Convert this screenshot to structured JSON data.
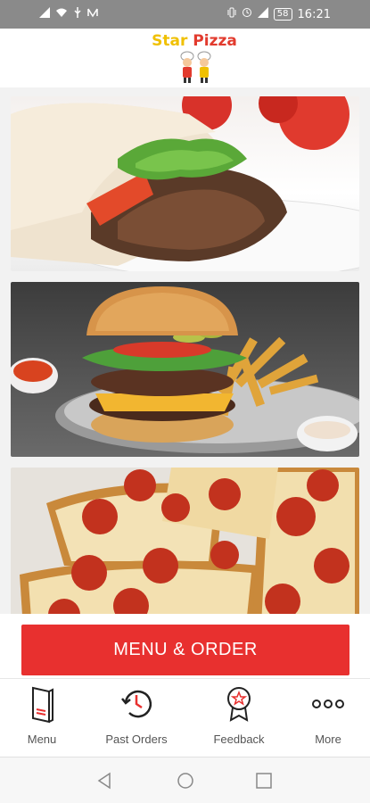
{
  "status_bar": {
    "left_icons": [
      "signal-icon",
      "wifi-icon",
      "usb-icon",
      "notification-icon"
    ],
    "right_icons": [
      "vibrate-icon",
      "alarm-icon",
      "cellular-icon"
    ],
    "battery": "58",
    "time": "16:21"
  },
  "header": {
    "logo_word1": "Star",
    "logo_word2": "Pizza"
  },
  "tiles": [
    {
      "name": "doner-kebab-wrap-image"
    },
    {
      "name": "burger-and-fries-image"
    },
    {
      "name": "pepperoni-pizza-image"
    }
  ],
  "cta": {
    "label": "MENU & ORDER",
    "color": "#e8302f"
  },
  "bottom_nav": {
    "items": [
      {
        "label": "Menu",
        "icon": "menu-book-icon"
      },
      {
        "label": "Past Orders",
        "icon": "history-clock-icon"
      },
      {
        "label": "Feedback",
        "icon": "award-star-icon"
      },
      {
        "label": "More",
        "icon": "more-dots-icon"
      }
    ]
  },
  "system_nav": {
    "buttons": [
      "back-icon",
      "home-icon",
      "recents-icon"
    ]
  },
  "colors": {
    "accent": "#e8302f",
    "status_bar": "#8a8a8a"
  }
}
